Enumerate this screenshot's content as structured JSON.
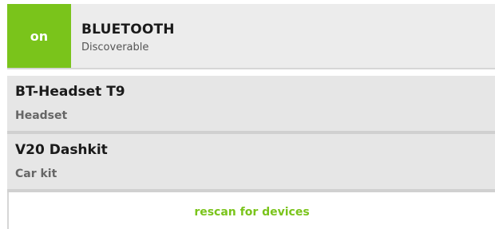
{
  "header": {
    "toggle_label": "on",
    "title": "BLUETOOTH",
    "subtitle": "Discoverable"
  },
  "devices": [
    {
      "name": "BT-Headset T9",
      "type": "Headset"
    },
    {
      "name": "V20 Dashkit",
      "type": "Car kit"
    }
  ],
  "actions": {
    "rescan_label": "rescan for devices"
  },
  "colors": {
    "accent": "#7ac41b",
    "row_background": "#e6e6e6",
    "header_background": "#ececec"
  }
}
